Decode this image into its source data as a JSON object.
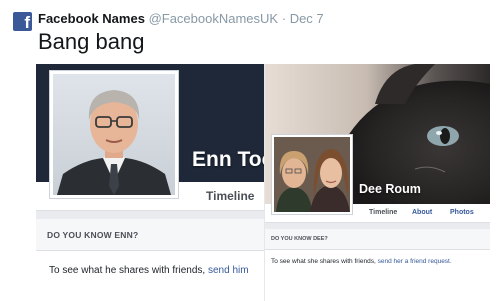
{
  "tweet": {
    "author_name": "Facebook Names",
    "handle": "@FacebookNamesUK",
    "separator": "·",
    "date": "Dec 7",
    "text": "Bang bang",
    "logo_letter": "f",
    "logo_icon": "facebook-logo-icon"
  },
  "enn_profile": {
    "name": "Enn Too",
    "tab_timeline": "Timeline",
    "know_title": "DO YOU KNOW ENN?",
    "know_text": "To see what he shares with friends, ",
    "know_link": "send him"
  },
  "dee_profile": {
    "name": "Dee Roum",
    "tabs": [
      "Timeline",
      "About",
      "Photos"
    ],
    "know_title": "DO YOU KNOW DEE?",
    "know_text": "To see what she shares with friends, ",
    "know_link": "send her a friend request."
  },
  "colors": {
    "facebook_blue": "#3b5998",
    "link_blue": "#365899",
    "twitter_gray": "#8899a6",
    "text_dark": "#14171a"
  }
}
